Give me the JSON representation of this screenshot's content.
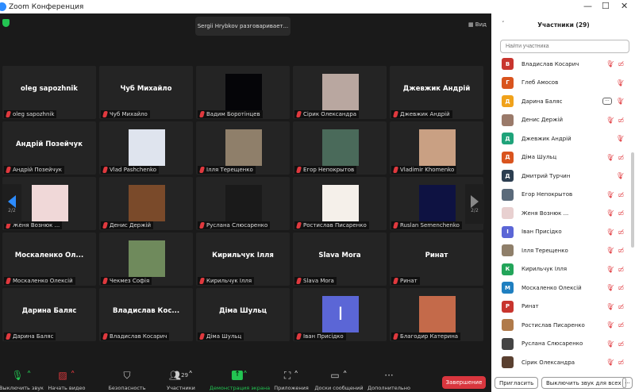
{
  "window": {
    "title": "Zoom Конференция",
    "minimize": "—",
    "maximize": "☐",
    "close": "✕"
  },
  "top": {
    "speaker": "Sergii Hrybkov разговаривает...",
    "view": "Вид"
  },
  "pager": {
    "left": "2/2",
    "right": "2/2"
  },
  "tiles": [
    {
      "big": "oleg sapozhnik",
      "label": "oleg sapozhnik"
    },
    {
      "big": "Чуб Михайло",
      "label": "Чуб Михайло"
    },
    {
      "pic": "#050508",
      "label": "Вадим Боротінцев"
    },
    {
      "pic": "#b9a7a0",
      "label": "Сірик Олександра"
    },
    {
      "big": "Джевжик Андрій",
      "label": "Джевжик Андрій"
    },
    {
      "big": "Андрій Позейчук",
      "label": "Андрій Позейчук"
    },
    {
      "pic": "#dfe4ee",
      "label": "Vlad Pashchenko"
    },
    {
      "pic": "#8f7f6a",
      "label": "Ілля Терещенко"
    },
    {
      "pic": "#4a6a5a",
      "label": "Егор Непокрытов"
    },
    {
      "pic": "#c9a083",
      "label": "Vladimir Khomenko"
    },
    {
      "pic": "#f0d8d8",
      "label": "Женя Вознюк ..."
    },
    {
      "pic": "#7a4a2a",
      "label": "Денис Держій"
    },
    {
      "pic": "#1a1a1a",
      "label": "Руслана Слюсаренко"
    },
    {
      "pic": "#f5f0ea",
      "label": "Ростислав Писаренко"
    },
    {
      "pic": "#0e1242",
      "label": "Ruslan Semenchenko"
    },
    {
      "big": "Москаленко  Ол...",
      "label": "Москаленко Олексій"
    },
    {
      "pic": "#6f8a5c",
      "label": "Чекмез Софія"
    },
    {
      "big": "Кирильчук Ілля",
      "label": "Кирильчук Ілля"
    },
    {
      "big": "Slava Mora",
      "label": "Slava Mora"
    },
    {
      "big": "Ринат",
      "label": "Ринат"
    },
    {
      "big": "Дарина Баляс",
      "label": "Дарина Баляс"
    },
    {
      "big": "Владислав  Кос...",
      "label": "Владислав Косарич"
    },
    {
      "big": "Діма Шульц",
      "label": "Діма Шульц"
    },
    {
      "pic": "#5b66d6",
      "letter": "І",
      "label": "Іван Присідко"
    },
    {
      "pic": "#c46a4a",
      "label": "Благодир Катерина"
    }
  ],
  "toolbar": {
    "mute": "Выключить звук",
    "video": "Начать видео",
    "security": "Безопасность",
    "participants": "Участники",
    "participants_count": "29",
    "share": "Демонстрация экрана",
    "apps": "Приложения",
    "boards": "Доски сообщений",
    "more": "Дополнительно",
    "end": "Завершение"
  },
  "panel": {
    "title": "Участники (29)",
    "search_placeholder": "Найти участника",
    "invite": "Пригласить",
    "mute_all": "Выключить звук для всех",
    "more": "···",
    "participants": [
      {
        "letter": "В",
        "color": "#c8352e",
        "name": "Владислав Косарич",
        "video": true
      },
      {
        "letter": "Г",
        "color": "#d9541e",
        "name": "Глеб Амосов",
        "video": false
      },
      {
        "letter": "Д",
        "color": "#f0a21b",
        "name": "Дарина Баляс",
        "video": false,
        "more": true
      },
      {
        "letter": "",
        "color": "#9a7a6a",
        "name": "Денис Держій",
        "video": true
      },
      {
        "letter": "Д",
        "color": "#1fa37a",
        "name": "Джевжик Андрій",
        "video": false
      },
      {
        "letter": "Д",
        "color": "#d9541e",
        "name": "Діма Шульц",
        "video": true
      },
      {
        "letter": "Д",
        "color": "#2c3e50",
        "name": "Дмитрий Турчин",
        "video": false
      },
      {
        "letter": "",
        "color": "#5a6a7a",
        "name": "Егор Непокрытов",
        "video": true
      },
      {
        "letter": "",
        "color": "#e8d0d0",
        "name": "Женя Вознюк ...",
        "video": true
      },
      {
        "letter": "І",
        "color": "#5b66d6",
        "name": "Іван Присідко",
        "video": true
      },
      {
        "letter": "",
        "color": "#8f7f6a",
        "name": "Ілля Терещенко",
        "video": true
      },
      {
        "letter": "К",
        "color": "#23a55a",
        "name": "Кирильчук Ілля",
        "video": true
      },
      {
        "letter": "М",
        "color": "#1f7fc0",
        "name": "Москаленко Олексій",
        "video": true
      },
      {
        "letter": "Р",
        "color": "#c8352e",
        "name": "Ринат",
        "video": true
      },
      {
        "letter": "",
        "color": "#b07a4a",
        "name": "Ростислав Писаренко",
        "video": true
      },
      {
        "letter": "",
        "color": "#444",
        "name": "Руслана Слюсаренко",
        "video": true
      },
      {
        "letter": "",
        "color": "#5a4030",
        "name": "Сірик Олександра",
        "video": true
      }
    ]
  }
}
